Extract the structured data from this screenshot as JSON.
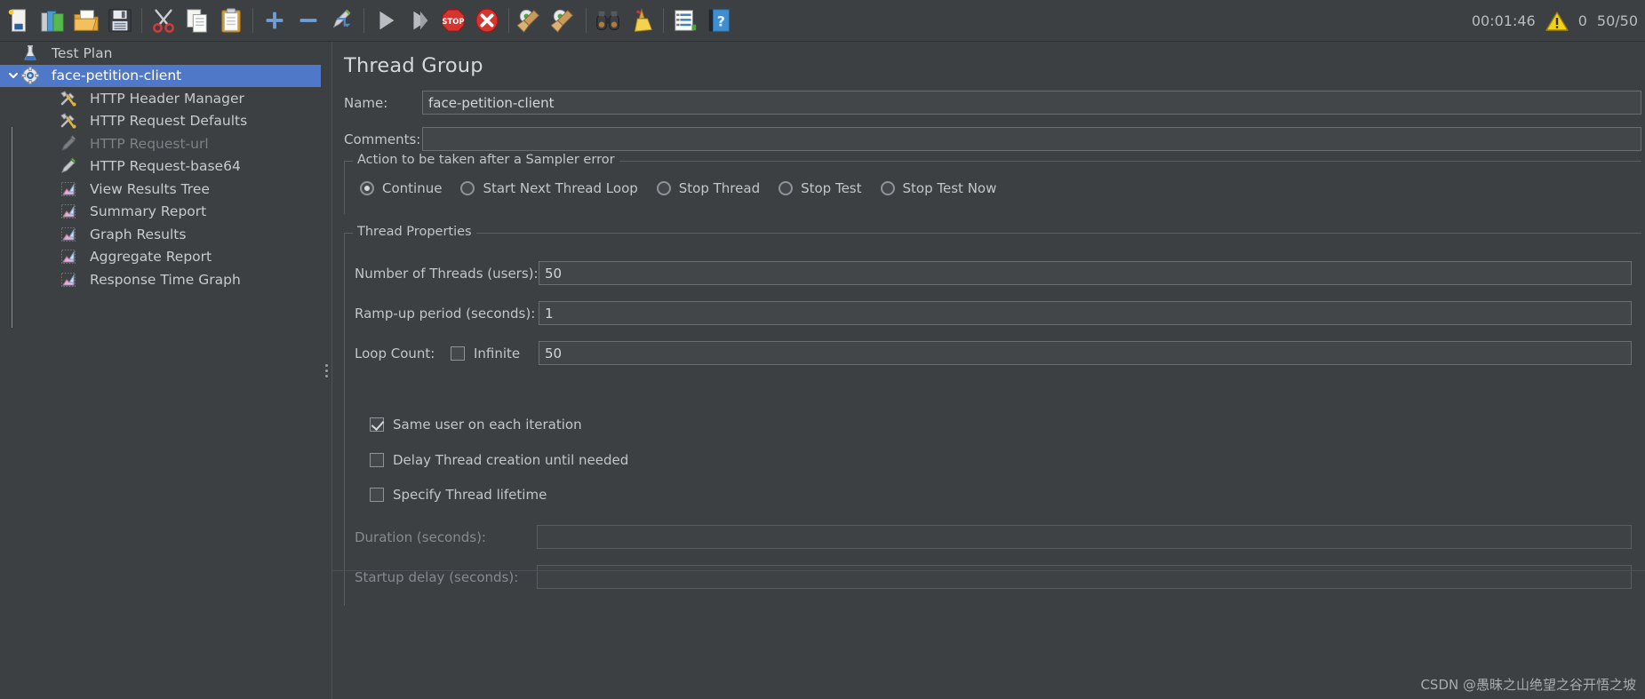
{
  "toolbar": {
    "buttons": [
      {
        "name": "new-test-plan-button",
        "icon": "new-document-icon",
        "tip": "New"
      },
      {
        "name": "templates-button",
        "icon": "templates-books-icon",
        "tip": "Templates"
      },
      {
        "name": "open-button",
        "icon": "open-folder-icon",
        "tip": "Open"
      },
      {
        "name": "save-button",
        "icon": "save-floppy-icon",
        "tip": "Save"
      },
      {
        "name": "cut-button",
        "icon": "scissors-icon",
        "tip": "Cut"
      },
      {
        "name": "copy-button",
        "icon": "copy-pages-icon",
        "tip": "Copy"
      },
      {
        "name": "paste-button",
        "icon": "clipboard-icon",
        "tip": "Paste"
      },
      {
        "name": "expand-all-button",
        "icon": "plus-icon",
        "tip": "Expand All"
      },
      {
        "name": "collapse-all-button",
        "icon": "minus-icon",
        "tip": "Collapse All"
      },
      {
        "name": "toggle-button",
        "icon": "pencil-toggle-icon",
        "tip": "Toggle"
      },
      {
        "name": "start-button",
        "icon": "play-triangle-icon",
        "tip": "Start"
      },
      {
        "name": "start-no-pauses-button",
        "icon": "play-no-pause-icon",
        "tip": "Start no pauses"
      },
      {
        "name": "stop-button",
        "icon": "stop-sign-icon",
        "tip": "Stop"
      },
      {
        "name": "shutdown-button",
        "icon": "shutdown-x-icon",
        "tip": "Shutdown"
      },
      {
        "name": "clear-button",
        "icon": "gear-broom-icon",
        "tip": "Clear"
      },
      {
        "name": "clear-all-button",
        "icon": "gear-broom-all-icon",
        "tip": "Clear All"
      },
      {
        "name": "search-button",
        "icon": "binoculars-icon",
        "tip": "Search"
      },
      {
        "name": "reset-search-button",
        "icon": "broom-icon",
        "tip": "Reset Search"
      },
      {
        "name": "function-helper-button",
        "icon": "function-list-icon",
        "tip": "Function Helper Dialog"
      },
      {
        "name": "help-button",
        "icon": "help-book-icon",
        "tip": "Help"
      }
    ],
    "separators_after": [
      3,
      6,
      9,
      13,
      15,
      17
    ]
  },
  "status": {
    "elapsed": "00:01:46",
    "warning_icon": "warning-triangle-icon",
    "error_count": "0",
    "threads": "50/50"
  },
  "tree": {
    "items": [
      {
        "label": "Test Plan",
        "icon": "test-plan-icon",
        "depth": 0,
        "selected": false,
        "disabled": false,
        "twisty": ""
      },
      {
        "label": "face-petition-client",
        "icon": "thread-group-gear-icon",
        "depth": 0,
        "selected": true,
        "disabled": false,
        "twisty": "expanded"
      },
      {
        "label": "HTTP Header Manager",
        "icon": "config-tools-icon",
        "depth": 1,
        "selected": false,
        "disabled": false,
        "twisty": ""
      },
      {
        "label": "HTTP Request Defaults",
        "icon": "config-tools-icon",
        "depth": 1,
        "selected": false,
        "disabled": false,
        "twisty": ""
      },
      {
        "label": "HTTP Request-url",
        "icon": "sampler-pen-disabled-icon",
        "depth": 1,
        "selected": false,
        "disabled": true,
        "twisty": ""
      },
      {
        "label": "HTTP Request-base64",
        "icon": "sampler-pen-icon",
        "depth": 1,
        "selected": false,
        "disabled": false,
        "twisty": ""
      },
      {
        "label": "View Results Tree",
        "icon": "listener-chart-icon",
        "depth": 1,
        "selected": false,
        "disabled": false,
        "twisty": ""
      },
      {
        "label": "Summary Report",
        "icon": "listener-chart-icon",
        "depth": 1,
        "selected": false,
        "disabled": false,
        "twisty": ""
      },
      {
        "label": "Graph Results",
        "icon": "listener-chart-icon",
        "depth": 1,
        "selected": false,
        "disabled": false,
        "twisty": ""
      },
      {
        "label": "Aggregate Report",
        "icon": "listener-chart-icon",
        "depth": 1,
        "selected": false,
        "disabled": false,
        "twisty": ""
      },
      {
        "label": "Response Time Graph",
        "icon": "listener-chart-icon",
        "depth": 1,
        "selected": false,
        "disabled": false,
        "twisty": ""
      }
    ]
  },
  "panel": {
    "title": "Thread Group",
    "name_label": "Name:",
    "name_value": "face-petition-client",
    "comments_label": "Comments:",
    "comments_value": "",
    "error_action": {
      "legend": "Action to be taken after a Sampler error",
      "options": [
        {
          "label": "Continue",
          "checked": true
        },
        {
          "label": "Start Next Thread Loop",
          "checked": false
        },
        {
          "label": "Stop Thread",
          "checked": false
        },
        {
          "label": "Stop Test",
          "checked": false
        },
        {
          "label": "Stop Test Now",
          "checked": false
        }
      ]
    },
    "thread_properties": {
      "legend": "Thread Properties",
      "threads_label": "Number of Threads (users):",
      "threads_value": "50",
      "rampup_label": "Ramp-up period (seconds):",
      "rampup_value": "1",
      "loop_label": "Loop Count:",
      "infinite_label": "Infinite",
      "infinite_checked": false,
      "loop_value": "50",
      "same_user_label": "Same user on each iteration",
      "same_user_checked": true,
      "delay_thread_label": "Delay Thread creation until needed",
      "delay_thread_checked": false,
      "specify_lifetime_label": "Specify Thread lifetime",
      "specify_lifetime_checked": false,
      "duration_label": "Duration (seconds):",
      "duration_value": "",
      "duration_disabled": true,
      "startup_label": "Startup delay (seconds):",
      "startup_value": "",
      "startup_disabled": true
    }
  },
  "watermark": "CSDN @愚昧之山绝望之谷开悟之坡",
  "colors": {
    "background": "#3c4043",
    "selection": "#5078c8",
    "text": "#c3c6c9",
    "disabled_text": "#7e8185",
    "field_bg": "#434649",
    "border": "#6a6e72"
  }
}
